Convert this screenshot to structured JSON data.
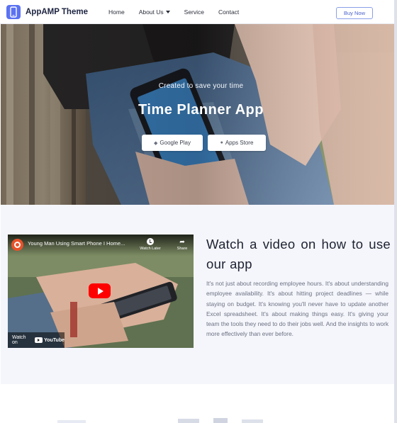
{
  "navbar": {
    "brand": "AppAMP Theme",
    "links": [
      "Home",
      "About Us",
      "Service",
      "Contact"
    ],
    "buy_label": "Buy Now"
  },
  "hero": {
    "subtitle": "Created to save your time",
    "title": "Time Planner App",
    "google_play_label": "Google Play",
    "apps_store_label": "Apps Store"
  },
  "video": {
    "title": "Young Man Using Smart Phone I Home...",
    "watch_later": "Watch Later",
    "share": "Share",
    "watch_on": "Watch on",
    "youtube": "YouTube"
  },
  "section": {
    "heading": "Watch a video on how to use our app",
    "body": "It's not just about recording employee hours. It's about understanding employee availability. It's about hitting project deadlines — while staying on budget. It's knowing you'll never have to update another Excel spreadsheet. It's about making things easy. It's giving your team the tools they need to do their jobs well. And the insights to work more effectively than ever before."
  },
  "colors": {
    "accent": "#5b72f2",
    "section_bg": "#f5f6fc",
    "youtube_red": "#ff0000"
  },
  "icons": {
    "brand": "phone-icon",
    "play": "play-icon",
    "google": "android-icon",
    "apple": "apple-icon"
  }
}
